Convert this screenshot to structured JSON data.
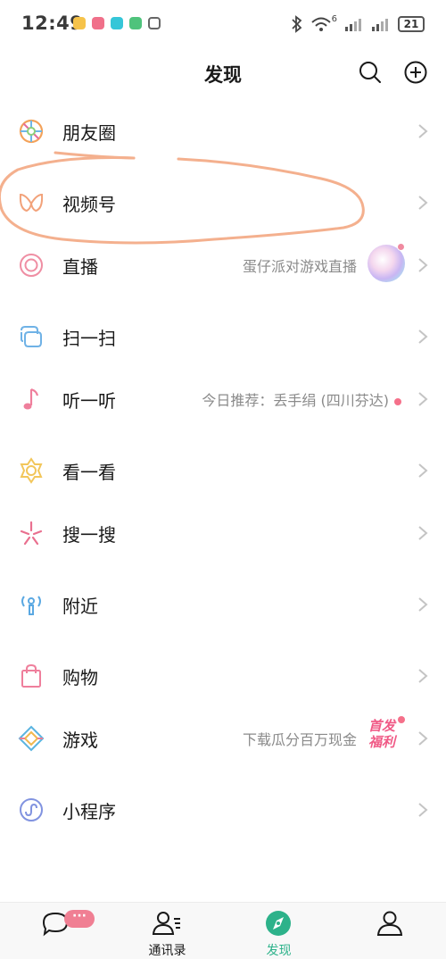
{
  "status_bar": {
    "time": "12:49",
    "network_label": "6",
    "battery": "21"
  },
  "header": {
    "title": "发现"
  },
  "items": [
    {
      "label": "朋友圈",
      "icon": "moments-icon",
      "sub": ""
    },
    {
      "label": "视频号",
      "icon": "channels-icon",
      "sub": ""
    },
    {
      "label": "直播",
      "icon": "live-icon",
      "sub": "蛋仔派对游戏直播"
    },
    {
      "label": "扫一扫",
      "icon": "scan-icon",
      "sub": ""
    },
    {
      "label": "听一听",
      "icon": "music-note-icon",
      "sub": "今日推荐：丢手绢 (四川芬达)"
    },
    {
      "label": "看一看",
      "icon": "top-stories-icon",
      "sub": ""
    },
    {
      "label": "搜一搜",
      "icon": "search-sparkle-icon",
      "sub": ""
    },
    {
      "label": "附近",
      "icon": "nearby-icon",
      "sub": ""
    },
    {
      "label": "购物",
      "icon": "shopping-bag-icon",
      "sub": ""
    },
    {
      "label": "游戏",
      "icon": "game-icon",
      "sub": "下载瓜分百万现金"
    },
    {
      "label": "小程序",
      "icon": "mini-program-icon",
      "sub": ""
    }
  ],
  "promo": {
    "line1": "首发",
    "line2": "福利"
  },
  "tabbar": {
    "chats_badge": "···",
    "tabs": [
      {
        "label": "",
        "icon": "chat-bubble-icon"
      },
      {
        "label": "通讯录",
        "icon": "contacts-icon"
      },
      {
        "label": "发现",
        "icon": "compass-icon"
      },
      {
        "label": "",
        "icon": "me-icon"
      }
    ]
  },
  "colors": {
    "accent_green": "#2db28a",
    "annotation_orange": "#f4b08e",
    "badge_pink": "#f07f93"
  }
}
